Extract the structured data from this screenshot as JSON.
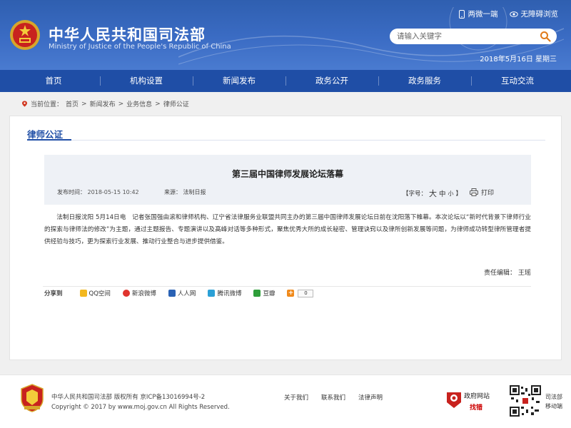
{
  "header": {
    "title": "中华人民共和国司法部",
    "subtitle": "Ministry of Justice of the People's Republic of China",
    "links": [
      {
        "label": "两微一端",
        "icon": "phone-icon"
      },
      {
        "label": "无障碍浏览",
        "icon": "eye-icon"
      }
    ],
    "search": {
      "placeholder": "请输入关键字"
    },
    "date": "2018年5月16日 星期三",
    "colors": {
      "primary": "#2f5fb0",
      "nav": "#1f4ea6"
    }
  },
  "nav": {
    "items": [
      "首页",
      "机构设置",
      "新闻发布",
      "政务公开",
      "政务服务",
      "互动交流"
    ]
  },
  "breadcrumb": {
    "prefix": "当前位置：",
    "items": [
      "首页",
      "新闻发布",
      "业务信息",
      "律师公证"
    ],
    "separator": ">"
  },
  "section": {
    "title": "律师公证"
  },
  "article": {
    "title": "第三届中国律师发展论坛落幕",
    "publish_label": "发布时间：",
    "publish_time": "2018-05-15 10:42",
    "source_label": "来源：",
    "source": "法制日报",
    "font_size_label": "【字号：",
    "font_sizes": [
      "大",
      "中",
      "小"
    ],
    "font_size_end": "】",
    "print_label": "打印",
    "body": "法制日报沈阳 5月14日电　记者张国强由滚和律师机构、辽宁省法律服务业联盟共同主办的第三届中国律师发展论坛日前在沈阳落下帷幕。本次论坛以“新时代背景下律师行业的探索与律师法的修改”为主题，通过主题报告、专题演讲以及高峰对话等多种形式，聚焦优秀大所的成长秘密、管理诀窍以及律所创新发展等问题，为律师成功转型律所管理者提供经验与技巧，更为探索行业发展、推动行业整合与进步提供借鉴。",
    "editor_label": "责任编辑：",
    "editor": "王瑶"
  },
  "share": {
    "label": "分享到",
    "items": [
      {
        "label": "QQ空间",
        "icon": "qzone-icon",
        "color": "#f3b81f"
      },
      {
        "label": "新浪微博",
        "icon": "weibo-icon",
        "color": "#e0342e"
      },
      {
        "label": "人人网",
        "icon": "renren-icon",
        "color": "#2a62b5"
      },
      {
        "label": "腾讯微博",
        "icon": "tencent-weibo-icon",
        "color": "#2ba0d6"
      },
      {
        "label": "豆瓣",
        "icon": "douban-icon",
        "color": "#2e9e3a"
      }
    ],
    "count": "0"
  },
  "footer": {
    "copyright_line1": "中华人民共和国司法部 版权所有 京ICP备13016994号-2",
    "copyright_line2": "Copyright © 2017 by www.moj.gov.cn All Rights Reserved.",
    "links": [
      "关于我们",
      "联系我们",
      "法律声明"
    ],
    "gov_label": "政府网站",
    "gov_error": "找错",
    "qr_caption": "司法部\n移动端",
    "qr_caption_1": "司法部",
    "qr_caption_2": "移动端"
  }
}
